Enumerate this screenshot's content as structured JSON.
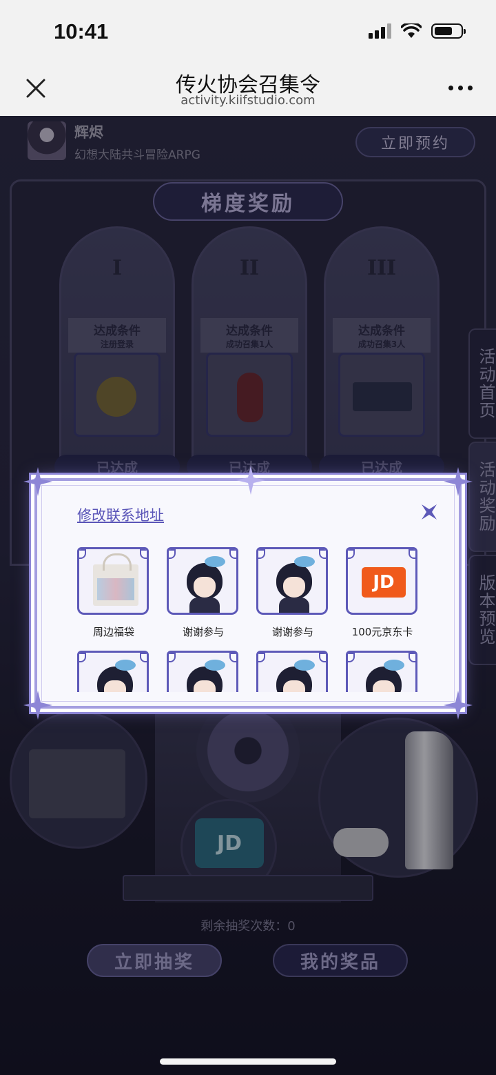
{
  "status_bar": {
    "time": "10:41"
  },
  "browser": {
    "title": "传火协会召集令",
    "url": "activity.kiifstudio.com"
  },
  "game": {
    "name": "辉烬",
    "description": "幻想大陆共斗冒险ARPG",
    "reserve_label": "立即预约"
  },
  "reward_panel": {
    "title": "梯度奖励",
    "tiers": [
      {
        "numeral": "I",
        "condition_title": "达成条件",
        "condition": "注册登录",
        "status": "已达成"
      },
      {
        "numeral": "II",
        "condition_title": "达成条件",
        "condition": "成功召集1人",
        "status": "已达成"
      },
      {
        "numeral": "III",
        "condition_title": "达成条件",
        "condition": "成功召集3人",
        "status": "已达成"
      }
    ]
  },
  "side_tabs": [
    "活动首页",
    "活动奖励",
    "版本预览"
  ],
  "lottery": {
    "jd_text": "JD",
    "remaining_label": "剩余抽奖次数：",
    "remaining_count": "0",
    "draw_label": "立即抽奖",
    "my_prizes_label": "我的奖品"
  },
  "modal": {
    "link_label": "修改联系地址",
    "prizes": [
      {
        "label": "周边福袋",
        "icon": "tote-bag-icon"
      },
      {
        "label": "谢谢参与",
        "icon": "chibi-character-icon"
      },
      {
        "label": "谢谢参与",
        "icon": "chibi-character-icon"
      },
      {
        "label": "100元京东卡",
        "icon": "jd-card-icon"
      },
      {
        "label": "",
        "icon": "chibi-character-icon"
      },
      {
        "label": "",
        "icon": "chibi-character-icon"
      },
      {
        "label": "",
        "icon": "chibi-character-icon"
      },
      {
        "label": "",
        "icon": "chibi-character-icon"
      }
    ],
    "jd_card_text": "JD"
  },
  "colors": {
    "modal_accent": "#5d59b8",
    "link": "#5a55b8",
    "jd_orange": "#f05a1b"
  }
}
